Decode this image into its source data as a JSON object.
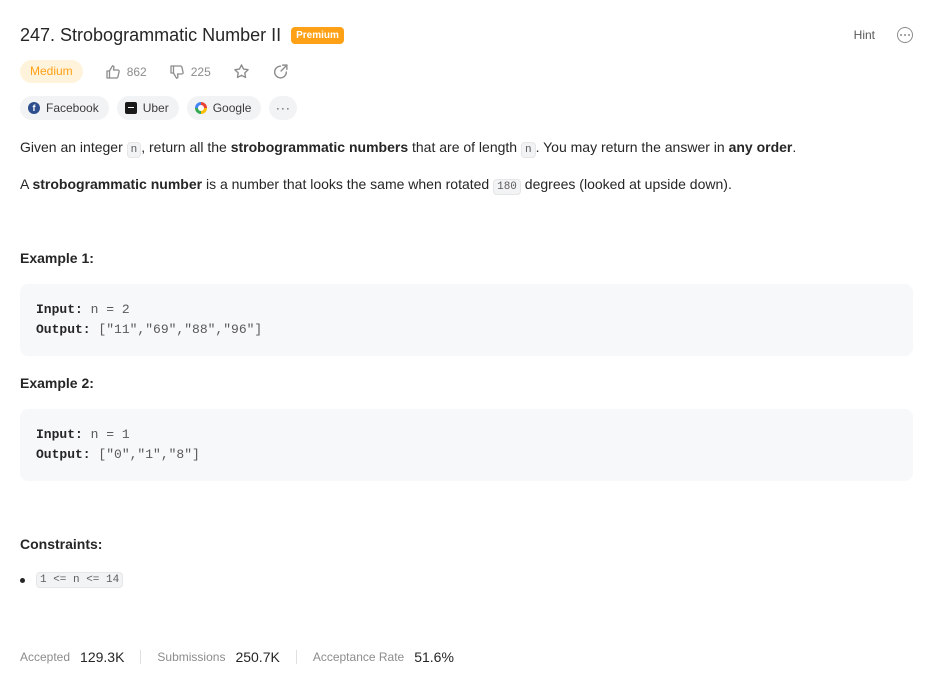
{
  "problem": {
    "title": "247. Strobogrammatic Number II",
    "premium_label": "Premium",
    "hint_label": "Hint"
  },
  "meta": {
    "difficulty": "Medium",
    "likes": "862",
    "dislikes": "225"
  },
  "companies": [
    {
      "name": "Facebook"
    },
    {
      "name": "Uber"
    },
    {
      "name": "Google"
    }
  ],
  "description": {
    "p1": {
      "t1": "Given an integer ",
      "code1": "n",
      "t2": ", return all the ",
      "b1": "strobogrammatic numbers",
      "t3": " that are of length ",
      "code2": "n",
      "t4": ". You may return the answer in ",
      "b2": "any order",
      "t5": "."
    },
    "p2": {
      "t1": "A ",
      "b1": "strobogrammatic number",
      "t2": " is a number that looks the same when rotated ",
      "code1": "180",
      "t3": " degrees (looked at upside down)."
    }
  },
  "examples": [
    {
      "title": "Example 1:",
      "input_label": "Input:",
      "input": " n = 2",
      "output_label": "Output:",
      "output": " [\"11\",\"69\",\"88\",\"96\"]"
    },
    {
      "title": "Example 2:",
      "input_label": "Input:",
      "input": " n = 1",
      "output_label": "Output:",
      "output": " [\"0\",\"1\",\"8\"]"
    }
  ],
  "constraints": {
    "title": "Constraints:",
    "items": [
      "1 <= n <= 14"
    ]
  },
  "stats": {
    "accepted_label": "Accepted",
    "accepted_value": "129.3K",
    "submissions_label": "Submissions",
    "submissions_value": "250.7K",
    "rate_label": "Acceptance Rate",
    "rate_value": "51.6%"
  },
  "colors": {
    "accent": "#ffa116",
    "difficulty_bg": "#fff3dc"
  },
  "icons": [
    "thumbs-up-icon",
    "thumbs-down-icon",
    "star-icon",
    "share-icon",
    "more-icon"
  ]
}
